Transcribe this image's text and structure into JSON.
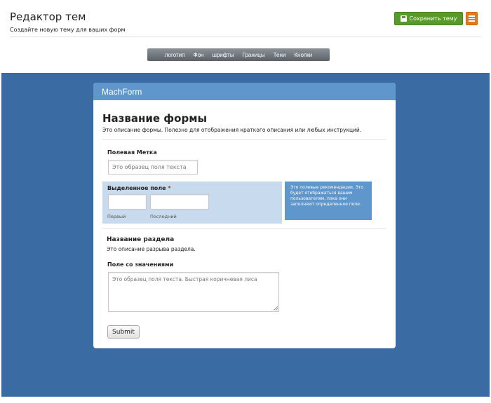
{
  "header": {
    "title": "Редактор тем",
    "subtitle": "Создайте новую тему для ваших форм",
    "save_button": "Сохранить тему",
    "menu_icon": "hamburger-icon"
  },
  "tabs": [
    "логотип",
    "Фон",
    "шрифты",
    "Границы",
    "Тени",
    "Кнопки"
  ],
  "colors": {
    "canvas": "#3a6ba2",
    "logo_bar": "#5f96cb",
    "save_button": "#5a9a2a",
    "menu_button": "#e07a20",
    "highlight": "#c8dbee"
  },
  "form": {
    "logo": "MachForm",
    "title": "Название формы",
    "description": "Это описание формы. Полезно для отображения краткого описания или любых инструкций.",
    "field1": {
      "label": "Полевая Метка",
      "placeholder": "Это образец поля текста"
    },
    "field2": {
      "label": "Выделенное поле",
      "required_mark": "*",
      "first": "Первый",
      "last": "Последний"
    },
    "guideline": "Это полевые рекомендации. Это будет отображаться вашим пользователям, пока они заполняют определенное поле.",
    "section": {
      "title": "Название раздела",
      "description": "Это описание разрыва раздела."
    },
    "field3": {
      "label": "Поле со значениями",
      "placeholder": "Это образец поля текста. Быстрая коричневая лиса"
    },
    "submit": "Submit"
  }
}
